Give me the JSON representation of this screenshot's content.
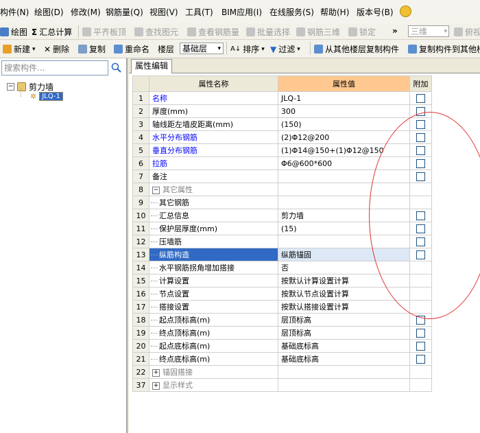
{
  "menubar": {
    "items": [
      "构件(N)",
      "绘图(D)",
      "修改(M)",
      "钢筋量(Q)",
      "视图(V)",
      "工具(T)",
      "BIM应用(I)",
      "在线服务(S)",
      "帮助(H)",
      "版本号(B)"
    ]
  },
  "toolbar1": {
    "draw": "绘图",
    "summary": "汇总计算",
    "flat_slab": "平齐板顶",
    "find_element": "查找图元",
    "view_rebar": "查看钢筋量",
    "batch_select": "批量选择",
    "rebar_3d": "钢筋三维",
    "lock": "锁定",
    "more": "»",
    "view_mode": "三维",
    "view2": "俯视"
  },
  "toolbar2": {
    "new": "新建",
    "delete": "删除",
    "copy": "复制",
    "rename": "重命名",
    "floor_label": "楼层",
    "floor_value": "基础层",
    "sort": "排序",
    "filter": "过滤",
    "copy_from_floor": "从其他楼层复制构件",
    "copy_to_floor": "复制构件到其他楼"
  },
  "search": {
    "placeholder": "搜索构件..."
  },
  "tree": {
    "root": "剪力墙",
    "child": "JLQ-1"
  },
  "tab": {
    "label": "属性编辑"
  },
  "grid": {
    "headers": {
      "name": "属性名称",
      "value": "属性值",
      "extra": "附加"
    },
    "rows": [
      {
        "no": "1",
        "name": "名称",
        "value": "JLQ-1"
      },
      {
        "no": "2",
        "name": "厚度(mm)",
        "value": "300"
      },
      {
        "no": "3",
        "name": "轴线距左墙皮距离(mm)",
        "value": "(150)"
      },
      {
        "no": "4",
        "name": "水平分布钢筋",
        "value": "(2)Φ12@200"
      },
      {
        "no": "5",
        "name": "垂直分布钢筋",
        "value": "(1)Φ14@150+(1)Φ12@150"
      },
      {
        "no": "6",
        "name": "拉筋",
        "value": "Φ6@600*600"
      },
      {
        "no": "7",
        "name": "备注",
        "value": ""
      },
      {
        "no": "8",
        "name": "其它属性",
        "value": ""
      },
      {
        "no": "9",
        "name": "其它钢筋",
        "value": ""
      },
      {
        "no": "10",
        "name": "汇总信息",
        "value": "剪力墙"
      },
      {
        "no": "11",
        "name": "保护层厚度(mm)",
        "value": "(15)"
      },
      {
        "no": "12",
        "name": "压墙筋",
        "value": ""
      },
      {
        "no": "13",
        "name": "纵筋构造",
        "value": "纵筋锚固"
      },
      {
        "no": "14",
        "name": "水平钢筋拐角增加搭接",
        "value": "否"
      },
      {
        "no": "15",
        "name": "计算设置",
        "value": "按默认计算设置计算"
      },
      {
        "no": "16",
        "name": "节点设置",
        "value": "按默认节点设置计算"
      },
      {
        "no": "17",
        "name": "搭接设置",
        "value": "按默认搭接设置计算"
      },
      {
        "no": "18",
        "name": "起点顶标高(m)",
        "value": "层顶标高"
      },
      {
        "no": "19",
        "name": "终点顶标高(m)",
        "value": "层顶标高"
      },
      {
        "no": "20",
        "name": "起点底标高(m)",
        "value": "基础底标高"
      },
      {
        "no": "21",
        "name": "终点底标高(m)",
        "value": "基础底标高"
      },
      {
        "no": "22",
        "name": "锚固搭接",
        "value": ""
      },
      {
        "no": "37",
        "name": "显示样式",
        "value": ""
      }
    ]
  },
  "colors": {
    "selected_row": "#316ac5",
    "header_value": "#ffc891",
    "blue_text": "#0000ff",
    "annotation": "#e03030"
  }
}
